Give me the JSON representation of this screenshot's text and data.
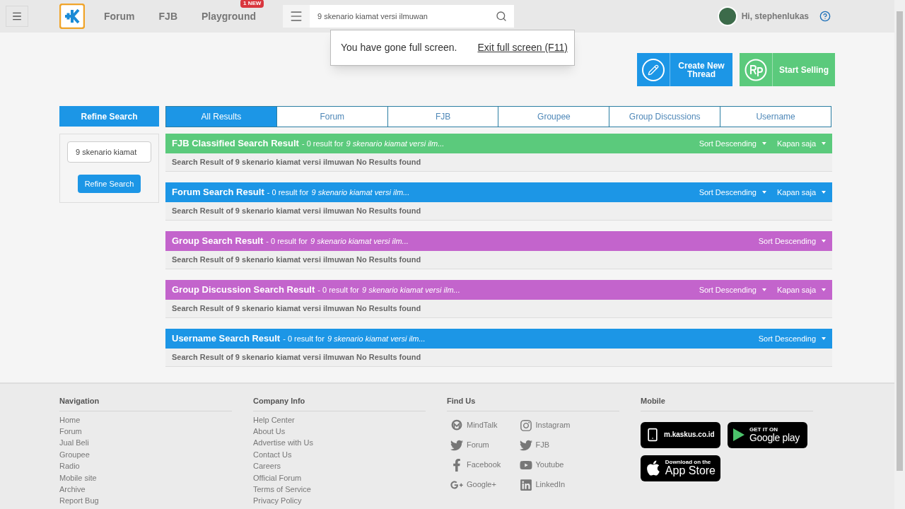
{
  "header": {
    "nav": [
      {
        "label": "Forum"
      },
      {
        "label": "FJB"
      },
      {
        "label": "Playground",
        "badge": "1 NEW"
      }
    ],
    "search": {
      "value": "9 skenario kiamat versi ilmuwan"
    },
    "user": {
      "greeting": "Hi, stephenlukas"
    }
  },
  "fullscreen_notice": {
    "message": "You have gone full screen.",
    "link": "Exit full screen (F11)"
  },
  "actions": [
    {
      "kind": "thread",
      "label": "Create New Thread",
      "color": "#1c96e6"
    },
    {
      "kind": "sell",
      "label": "Start Selling",
      "color": "#5bca7c"
    }
  ],
  "refine": {
    "title": "Refine Search",
    "value": "9 skenario kiamat",
    "button": "Refine Search"
  },
  "tabs": [
    {
      "label": "All Results",
      "selected": true
    },
    {
      "label": "Forum",
      "selected": false
    },
    {
      "label": "FJB",
      "selected": false
    },
    {
      "label": "Groupee",
      "selected": false
    },
    {
      "label": "Group Discussions",
      "selected": false
    },
    {
      "label": "Username",
      "selected": false
    }
  ],
  "sections": [
    {
      "title": "FJB Classified Search Result",
      "summary": "- 0 result for",
      "query": "9 skenario kiamat versi ilm...",
      "color": "#5bca7c",
      "sort": "Sort Descending",
      "time": "Kapan saja",
      "body": "Search Result of 9 skenario kiamat versi ilmuwan No Results found"
    },
    {
      "title": "Forum Search Result",
      "summary": "- 0 result for",
      "query": "9 skenario kiamat versi ilm...",
      "color": "#1c96e6",
      "sort": "Sort Descending",
      "time": "Kapan saja",
      "body": "Search Result of 9 skenario kiamat versi ilmuwan No Results found"
    },
    {
      "title": "Group Search Result",
      "summary": "- 0 result for",
      "query": "9 skenario kiamat versi ilm...",
      "color": "#c364cc",
      "sort": "Sort Descending",
      "body": "Search Result of 9 skenario kiamat versi ilmuwan No Results found"
    },
    {
      "title": "Group Discussion Search Result",
      "summary": "- 0 result for",
      "query": "9 skenario kiamat versi ilm...",
      "color": "#c364cc",
      "sort": "Sort Descending",
      "time": "Kapan saja",
      "body": "Search Result of 9 skenario kiamat versi ilmuwan No Results found"
    },
    {
      "title": "Username Search Result",
      "summary": "- 0 result for",
      "query": "9 skenario kiamat versi ilm...",
      "color": "#1c96e6",
      "sort": "Sort Descending",
      "body": "Search Result of 9 skenario kiamat versi ilmuwan No Results found"
    }
  ],
  "footer": {
    "navigation": {
      "title": "Navigation",
      "links": [
        "Home",
        "Forum",
        "Jual Beli",
        "Groupee",
        "Radio",
        "Mobile site",
        "Archive",
        "Report Bug"
      ]
    },
    "company": {
      "title": "Company Info",
      "links": [
        "Help Center",
        "About Us",
        "Advertise with Us",
        "Contact Us",
        "Careers",
        "Official Forum",
        "Terms of Service",
        "Privacy Policy"
      ]
    },
    "find_us": {
      "title": "Find Us",
      "links": [
        {
          "kind": "mindtalk",
          "label": "MindTalk"
        },
        {
          "kind": "instagram",
          "label": "Instagram"
        },
        {
          "kind": "twitter",
          "label": "Forum"
        },
        {
          "kind": "twitter",
          "label": "FJB"
        },
        {
          "kind": "facebook",
          "label": "Facebook"
        },
        {
          "kind": "youtube",
          "label": "Youtube"
        },
        {
          "kind": "googleplus",
          "label": "Google+"
        },
        {
          "kind": "linkedin",
          "label": "LinkedIn"
        }
      ]
    },
    "mobile": {
      "title": "Mobile",
      "badges": [
        {
          "kind": "site",
          "label": "m.kaskus.co.id"
        },
        {
          "kind": "play",
          "small": "GET IT ON",
          "label": "Google play"
        },
        {
          "kind": "apple",
          "small": "Download on the",
          "label": "App Store"
        }
      ]
    }
  }
}
